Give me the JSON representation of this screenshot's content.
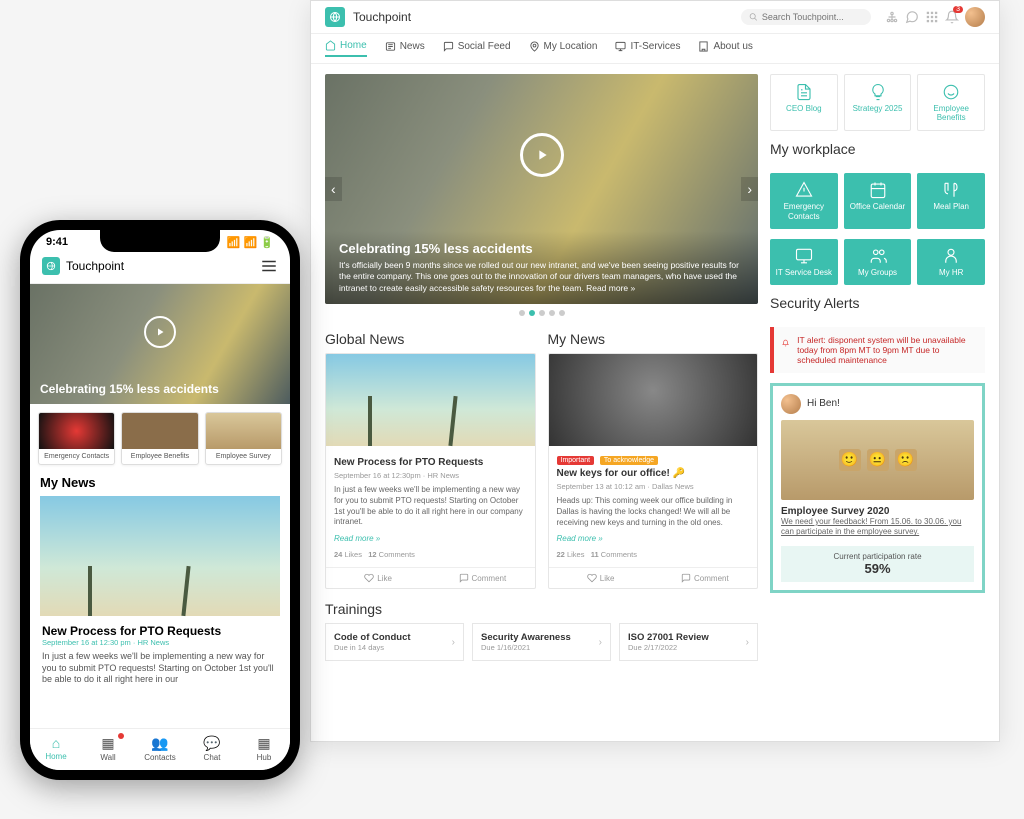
{
  "brand": "Touchpoint",
  "search": {
    "placeholder": "Search Touchpoint..."
  },
  "notifications_count": "3",
  "nav": [
    {
      "label": "Home",
      "icon": "home-icon"
    },
    {
      "label": "News",
      "icon": "news-icon"
    },
    {
      "label": "Social Feed",
      "icon": "chat-icon"
    },
    {
      "label": "My Location",
      "icon": "location-icon"
    },
    {
      "label": "IT-Services",
      "icon": "monitor-icon"
    },
    {
      "label": "About us",
      "icon": "building-icon"
    }
  ],
  "hero": {
    "title": "Celebrating 15% less accidents",
    "body": "It's officially been 9 months since we rolled out our new intranet, and we've been seeing positive results for the entire company. This one goes out to the innovation of our drivers team managers, who have used the intranet to create easily accessible safety resources for the team. Read more »"
  },
  "sections": {
    "global_news": "Global News",
    "my_news": "My News",
    "trainings": "Trainings",
    "my_workplace": "My workplace",
    "security_alerts": "Security Alerts"
  },
  "news1": {
    "title": "New Process for PTO Requests",
    "meta": "September 16 at 12:30pm · HR News",
    "excerpt": "In just a few weeks we'll be implementing a new way for you to submit PTO requests! Starting on October 1st you'll be able to do it all right here in our company intranet.",
    "readmore": "Read more »",
    "likes": "24",
    "likes_label": "Likes",
    "comments": "12",
    "comments_label": "Comments",
    "like_btn": "Like",
    "comment_btn": "Comment"
  },
  "news2": {
    "badge1": "Important",
    "badge2": "To acknowledge",
    "title": "New keys for our office!",
    "meta": "September 13 at 10:12 am · Dallas News",
    "excerpt": "Heads up: This coming week our office building in Dallas is having the locks changed! We will all be receiving new keys and turning in the old ones.",
    "readmore": "Read more »",
    "likes": "22",
    "likes_label": "Likes",
    "comments": "11",
    "comments_label": "Comments",
    "like_btn": "Like",
    "comment_btn": "Comment"
  },
  "trainings": [
    {
      "title": "Code of Conduct",
      "due": "Due in 14 days"
    },
    {
      "title": "Security Awareness",
      "due": "Due 1/16/2021"
    },
    {
      "title": "ISO 27001 Review",
      "due": "Due 2/17/2022"
    }
  ],
  "top_tiles": [
    {
      "label": "CEO Blog"
    },
    {
      "label": "Strategy 2025"
    },
    {
      "label": "Employee Benefits"
    }
  ],
  "workplace_tiles": [
    {
      "label": "Emergency Contacts"
    },
    {
      "label": "Office Calendar"
    },
    {
      "label": "Meal Plan"
    },
    {
      "label": "IT Service Desk"
    },
    {
      "label": "My Groups"
    },
    {
      "label": "My HR"
    }
  ],
  "alert": "IT alert: disponent system will be unavailable today from 8pm MT to 9pm MT due to scheduled maintenance",
  "survey": {
    "greeting": "Hi Ben!",
    "title": "Employee Survey 2020",
    "subtitle": "We need your feedback! From 15.06. to 30.06. you can participate in the employee survey.",
    "rate_label": "Current participation rate",
    "rate_value": "59%"
  },
  "mobile": {
    "time": "9:41",
    "hero_title": "Celebrating 15% less accidents",
    "tiles": [
      {
        "label": "Emergency Contacts"
      },
      {
        "label": "Employee Benefits"
      },
      {
        "label": "Employee Survey"
      }
    ],
    "section": "My News",
    "card": {
      "title": "New Process for PTO Requests",
      "meta": "September 16 at 12:30 pm · HR News",
      "body": "In just a few weeks we'll be implementing a new way for you to submit PTO requests! Starting on October 1st you'll be able to do it all right here in our",
      "link_text": "here"
    },
    "bottom_nav": [
      {
        "label": "Home"
      },
      {
        "label": "Wall"
      },
      {
        "label": "Contacts"
      },
      {
        "label": "Chat"
      },
      {
        "label": "Hub"
      }
    ]
  }
}
